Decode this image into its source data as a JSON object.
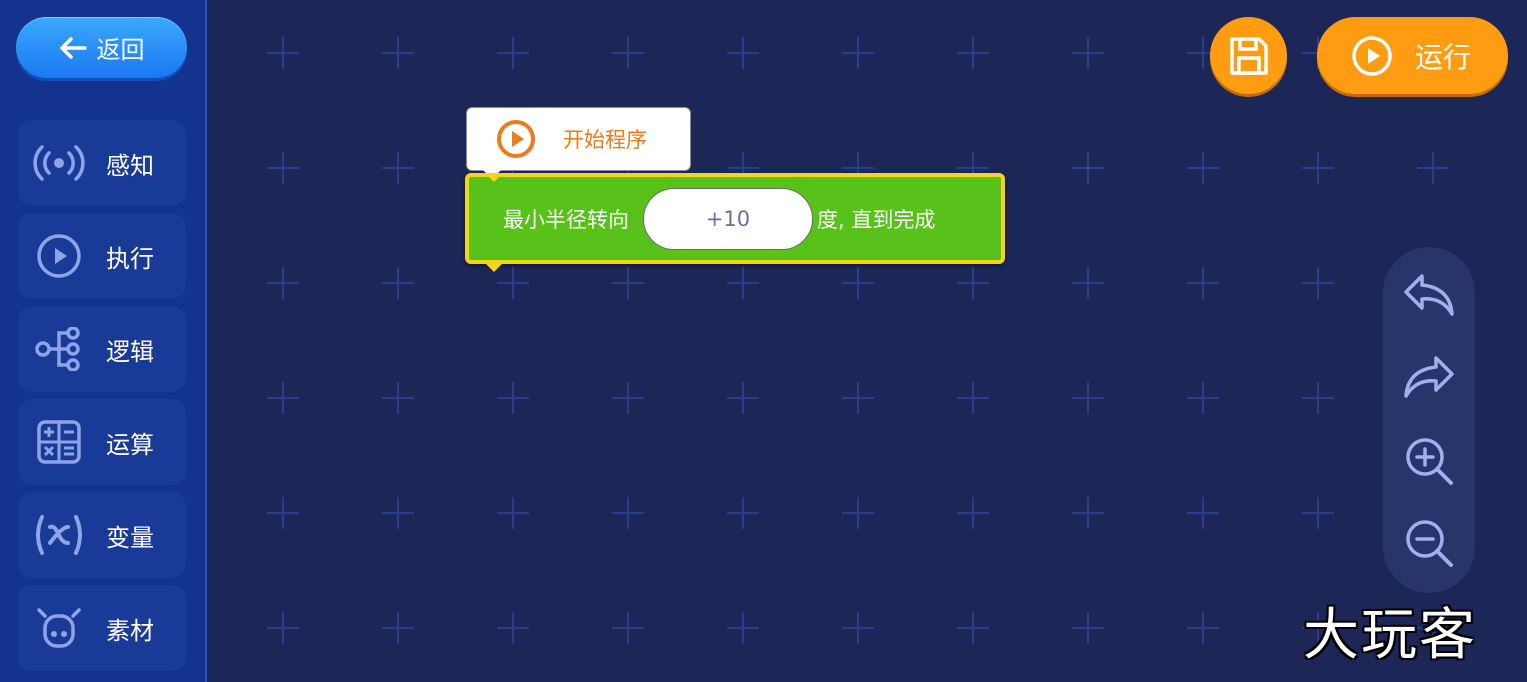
{
  "sidebar": {
    "back_label": "返回",
    "categories": [
      {
        "label": "感知",
        "icon": "broadcast-icon"
      },
      {
        "label": "执行",
        "icon": "play-circle-icon"
      },
      {
        "label": "逻辑",
        "icon": "logic-tree-icon"
      },
      {
        "label": "运算",
        "icon": "calculator-icon"
      },
      {
        "label": "变量",
        "icon": "variable-x-icon"
      },
      {
        "label": "素材",
        "icon": "robot-face-icon"
      }
    ]
  },
  "toolbar": {
    "save_icon": "floppy-disk-icon",
    "run_label": "运行"
  },
  "blocks": {
    "start": {
      "label": "开始程序"
    },
    "turn": {
      "prefix": "最小半径转向",
      "value": "+10",
      "suffix": "度, 直到完成"
    }
  },
  "tools": [
    "undo-icon",
    "redo-icon",
    "zoom-in-icon",
    "zoom-out-icon"
  ],
  "watermark": "大玩客",
  "colors": {
    "background": "#1c2657",
    "sidebar": "#14338f",
    "accent_orange": "#ff9c12",
    "block_green": "#59c21a",
    "block_outline": "#f2d51c",
    "start_label": "#ee7a1a"
  }
}
